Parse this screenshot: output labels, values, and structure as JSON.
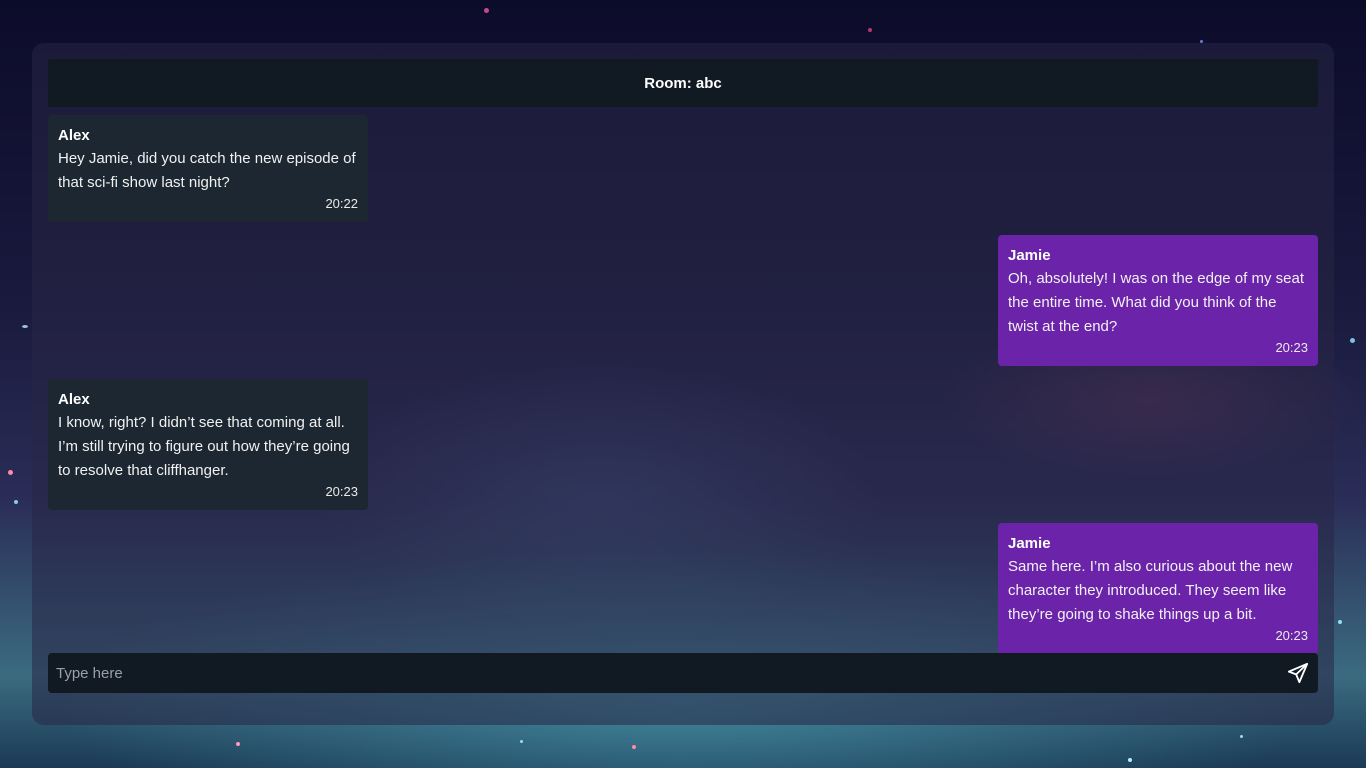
{
  "room": {
    "title": "Room: abc"
  },
  "messages": [
    {
      "sender": "Alex",
      "text": "Hey Jamie, did you catch the new episode of that sci-fi show last night?",
      "time": "20:22",
      "side": "left"
    },
    {
      "sender": "Jamie",
      "text": "Oh, absolutely! I was on the edge of my seat the entire time. What did you think of the twist at the end?",
      "time": "20:23",
      "side": "right"
    },
    {
      "sender": "Alex",
      "text": "I know, right? I didn’t see that coming at all. I’m still trying to figure out how they’re going to resolve that cliffhanger.",
      "time": "20:23",
      "side": "left"
    },
    {
      "sender": "Jamie",
      "text": "Same here. I’m also curious about the new character they introduced. They seem like they’re going to shake things up a bit.",
      "time": "20:23",
      "side": "right"
    }
  ],
  "composer": {
    "placeholder": "Type here",
    "send_icon": "send-icon"
  },
  "colors": {
    "header_bg": "#111923",
    "left_bubble": "#1c2731",
    "right_bubble": "#6b24a9"
  }
}
